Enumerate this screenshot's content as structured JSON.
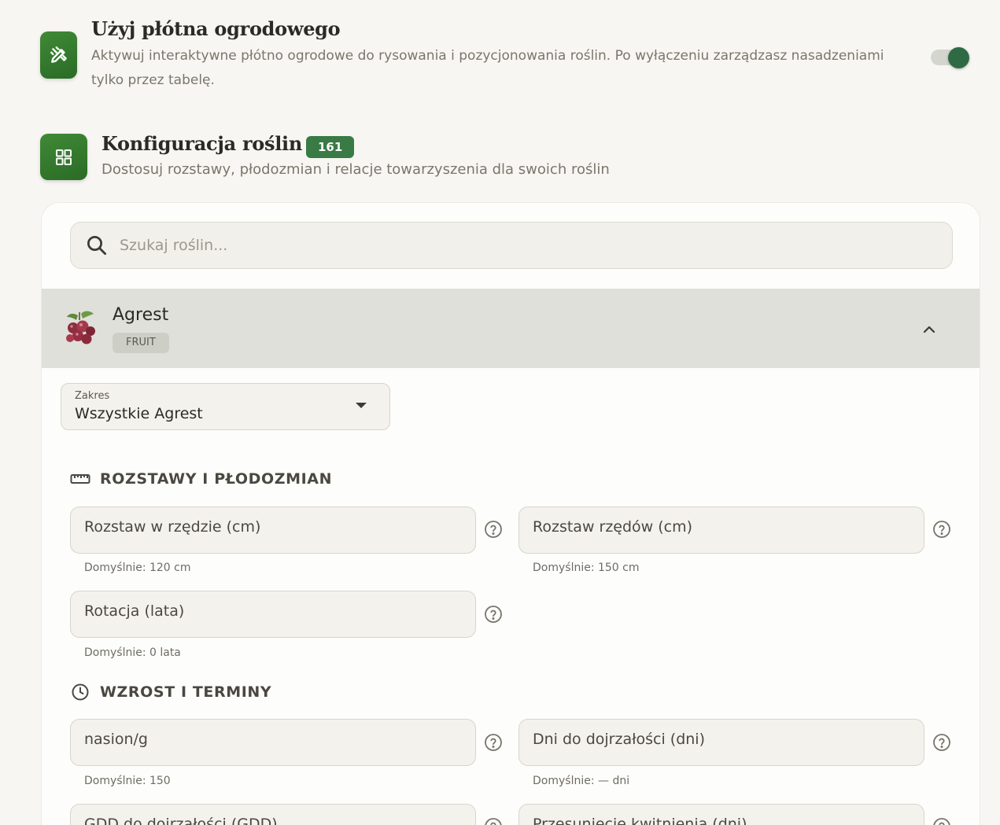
{
  "canvas_section": {
    "title": "Użyj płótna ogrodowego",
    "description": "Aktywuj interaktywne płótno ogrodowe do rysowania i pozycjonowania roślin. Po wyłączeniu zarządzasz nasadzeniami tylko przez tabelę.",
    "toggle_on": true,
    "icon": "pencil-ruler-icon"
  },
  "plants_section": {
    "title": "Konfiguracja roślin",
    "count": "161",
    "description": "Dostosuj rozstawy, płodozmian i relacje towarzyszenia dla swoich roślin",
    "icon": "grid-icon"
  },
  "search": {
    "placeholder": "Szukaj roślin..."
  },
  "plant": {
    "name": "Agrest",
    "category": "FRUIT",
    "expanded": true
  },
  "scope_select": {
    "label": "Zakres",
    "value": "Wszystkie Agrest"
  },
  "groups": {
    "spacing": {
      "title": "ROZSTAWY I PŁODOZMIAN",
      "fields": [
        {
          "label": "Rozstaw w rzędzie (cm)",
          "hint": "Domyślnie: 120 cm"
        },
        {
          "label": "Rozstaw rzędów (cm)",
          "hint": "Domyślnie: 150 cm"
        },
        {
          "label": "Rotacja (lata)",
          "hint": "Domyślnie: 0 lata"
        }
      ]
    },
    "growth": {
      "title": "WZROST I TERMINY",
      "fields": [
        {
          "label": "nasion/g",
          "hint": "Domyślnie: 150"
        },
        {
          "label": "Dni do dojrzałości (dni)",
          "hint": "Domyślnie: — dni"
        },
        {
          "label": "GDD do dojrzałości (GDD)",
          "hint": ""
        },
        {
          "label": "Przesunięcie kwitnienia (dni)",
          "hint": ""
        }
      ]
    }
  },
  "colors": {
    "accent_green": "#2e6b45",
    "badge_green": "#3a7a45",
    "tile_green": "#2b6b26",
    "background": "#f7f6f2"
  }
}
